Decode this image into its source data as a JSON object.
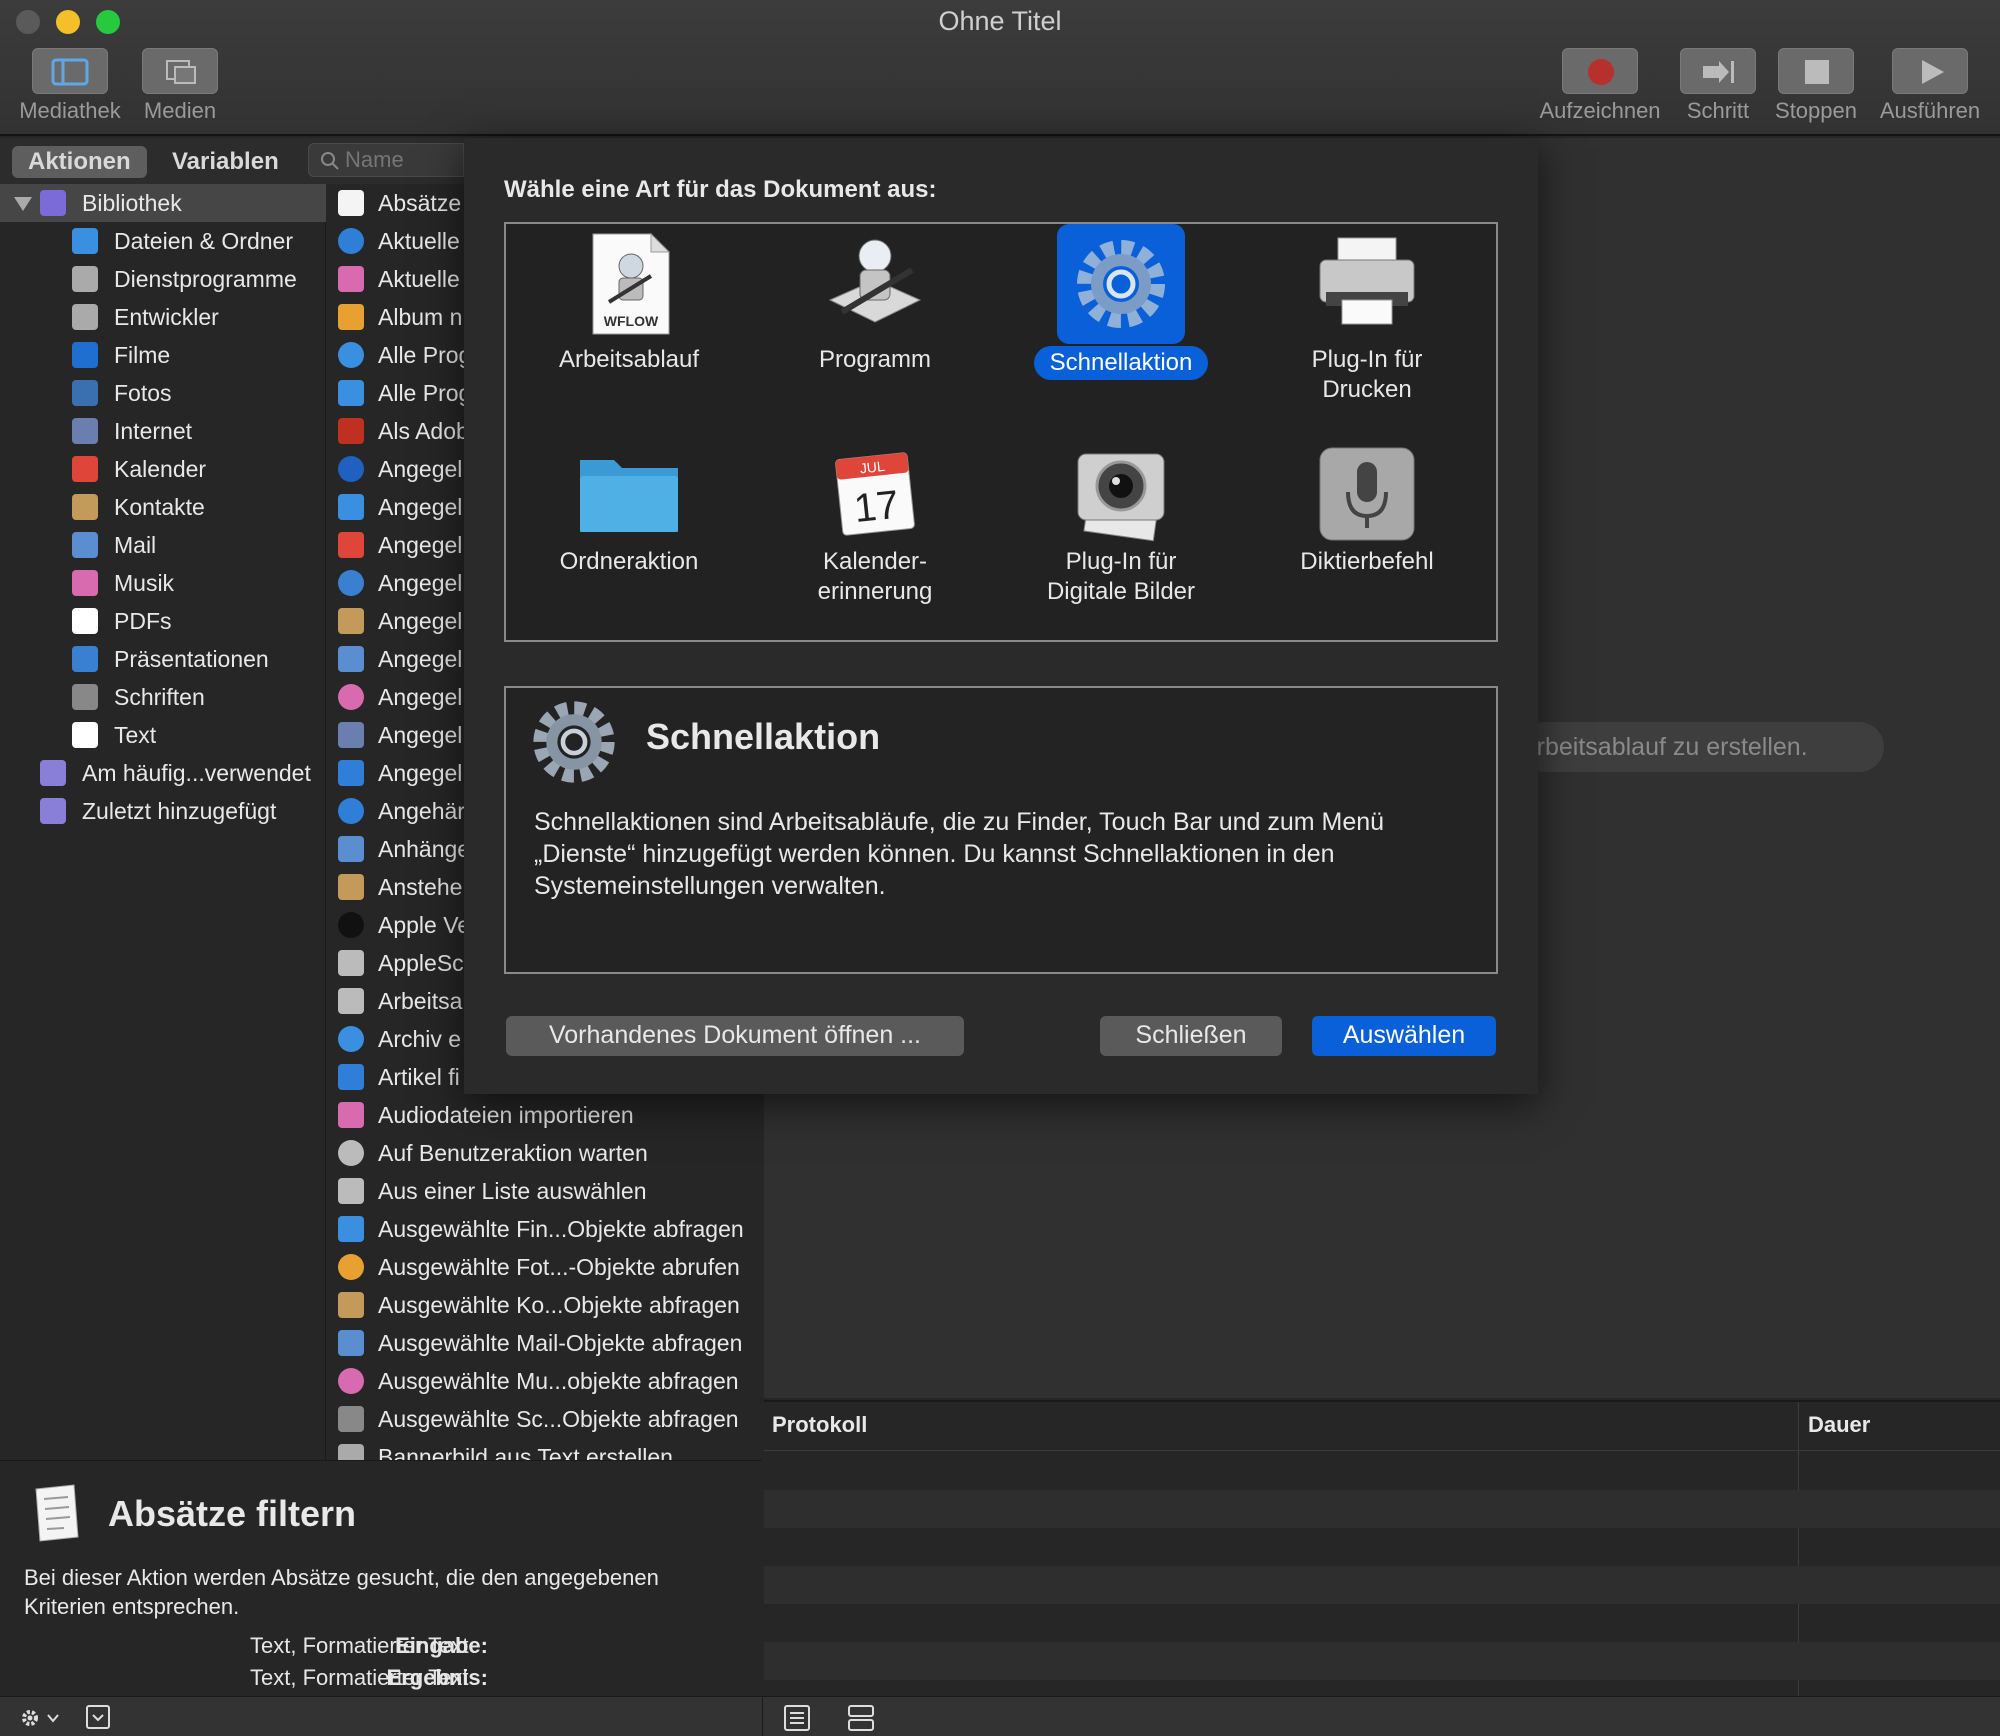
{
  "window": {
    "title": "Ohne Titel"
  },
  "toolbar": {
    "left": [
      {
        "label": "Mediathek"
      },
      {
        "label": "Medien"
      }
    ],
    "right": [
      {
        "label": "Aufzeichnen"
      },
      {
        "label": "Schritt"
      },
      {
        "label": "Stoppen"
      },
      {
        "label": "Ausführen"
      }
    ]
  },
  "tabs": {
    "actions": "Aktionen",
    "variables": "Variablen"
  },
  "search": {
    "placeholder": "Name"
  },
  "library": {
    "items": [
      "Bibliothek",
      "Dateien & Ordner",
      "Dienstprogramme",
      "Entwickler",
      "Filme",
      "Fotos",
      "Internet",
      "Kalender",
      "Kontakte",
      "Mail",
      "Musik",
      "PDFs",
      "Präsentationen",
      "Schriften",
      "Text",
      "Am häufig...verwendet",
      "Zuletzt hinzugefügt"
    ]
  },
  "actions": {
    "items": [
      "Absätze",
      "Aktuelle",
      "Aktuelle",
      "Album n",
      "Alle Prog",
      "Alle Prog",
      "Als Adob",
      "Angegel",
      "Angegel",
      "Angegel",
      "Angegel",
      "Angegel",
      "Angegel",
      "Angegel",
      "Angegel",
      "Angegel",
      "Angehär",
      "Anhänge",
      "Anstehe",
      "Apple Ve",
      "AppleSc",
      "Arbeitsa",
      "Archiv e",
      "Artikel fi",
      "Audiodateien importieren",
      "Auf Benutzeraktion warten",
      "Aus einer Liste auswählen",
      "Ausgewählte Fin...Objekte abfragen",
      "Ausgewählte Fot...-Objekte abrufen",
      "Ausgewählte Ko...Objekte abfragen",
      "Ausgewählte Mail-Objekte abfragen",
      "Ausgewählte Mu...objekte abfragen",
      "Ausgewählte Sc...Objekte abfragen",
      "Bannerbild aus Text erstellen"
    ]
  },
  "info": {
    "title": "Absätze filtern",
    "description": "Bei dieser Aktion werden Absätze gesucht, die den angegebenen Kriterien entsprechen.",
    "input_label": "Eingabe:",
    "input_value": "Text, Formatierter Text",
    "result_label": "Ergebnis:",
    "result_value": "Text, Formatierter Text"
  },
  "dialog": {
    "heading": "Wähle eine Art für das Dokument aus:",
    "types": [
      {
        "line1": "Arbeitsablauf",
        "line2": ""
      },
      {
        "line1": "Programm",
        "line2": ""
      },
      {
        "line1": "Schnellaktion",
        "line2": ""
      },
      {
        "line1": "Plug-In für",
        "line2": "Drucken"
      },
      {
        "line1": "Ordneraktion",
        "line2": ""
      },
      {
        "line1": "Kalender-",
        "line2": "erinnerung"
      },
      {
        "line1": "Plug-In für",
        "line2": "Digitale Bilder"
      },
      {
        "line1": "Diktierbefehl",
        "line2": ""
      }
    ],
    "wflow_text": "WFLOW",
    "cal_month": "JUL",
    "cal_day": "17",
    "desc_title": "Schnellaktion",
    "desc_text": "Schnellaktionen sind Arbeitsabläufe, die zu Finder, Touch Bar und zum Menü „Dienste“ hinzugefügt werden können. Du kannst Schnellaktionen in den Systemeinstellungen verwalten.",
    "open_btn": "Vorhandenes Dokument öffnen ...",
    "close_btn": "Schließen",
    "choose_btn": "Auswählen"
  },
  "canvas": {
    "hint": "Arbeitsablauf zu erstellen."
  },
  "log": {
    "col1": "Protokoll",
    "col2": "Dauer"
  },
  "colors": {
    "accent": "#0a60d8",
    "selection": "#0a60d8"
  }
}
